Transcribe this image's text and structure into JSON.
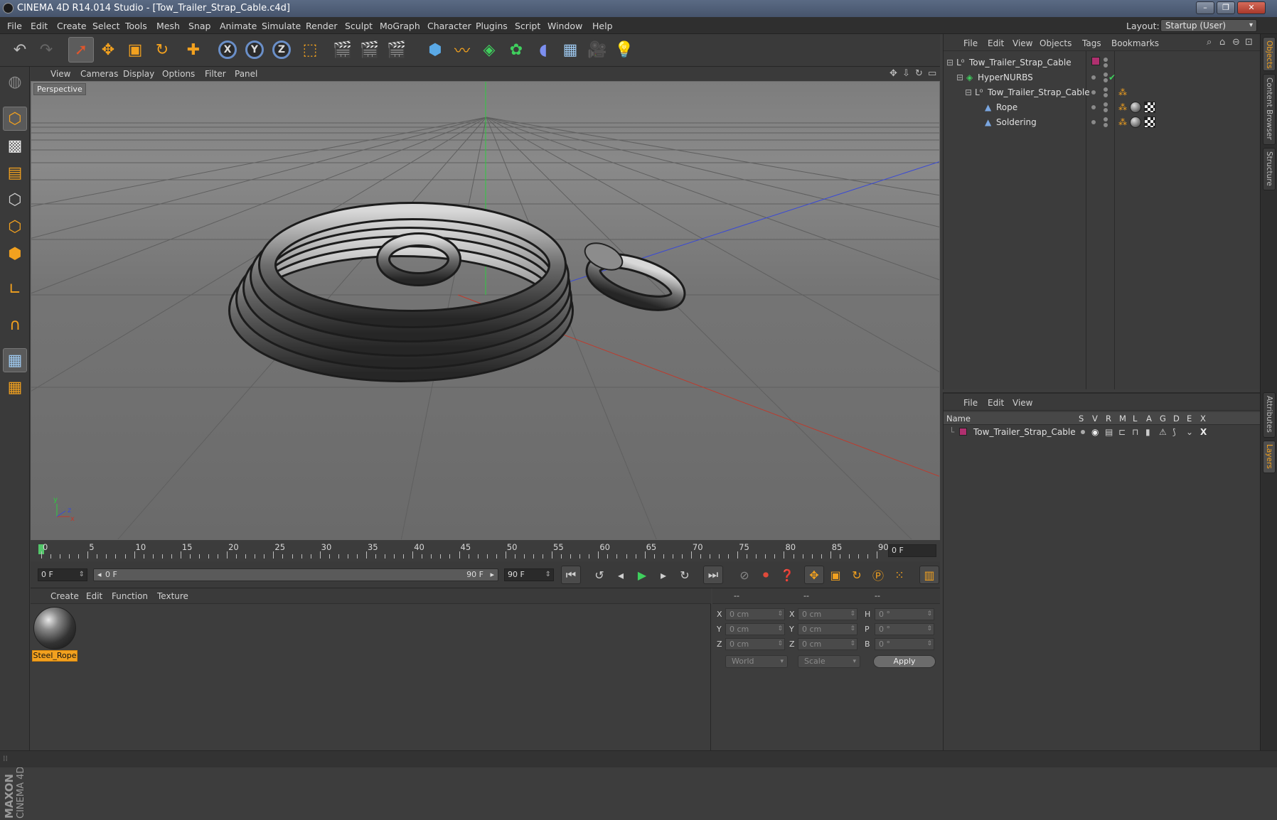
{
  "window": {
    "title": "CINEMA 4D R14.014 Studio - [Tow_Trailer_Strap_Cable.c4d]",
    "min": "–",
    "max": "❐",
    "close": "✕"
  },
  "menu": [
    "File",
    "Edit",
    "Create",
    "Select",
    "Tools",
    "Mesh",
    "Snap",
    "Animate",
    "Simulate",
    "Render",
    "Sculpt",
    "MoGraph",
    "Character",
    "Plugins",
    "Script",
    "Window",
    "Help"
  ],
  "layout": {
    "label": "Layout:",
    "value": "Startup (User)"
  },
  "toolbar": {
    "axis_x": "X",
    "axis_y": "Y",
    "axis_z": "Z"
  },
  "viewport": {
    "menu": [
      "View",
      "Cameras",
      "Display",
      "Options",
      "Filter",
      "Panel"
    ],
    "label": "Perspective",
    "axes": {
      "y": "y",
      "z": "z",
      "x": "x"
    }
  },
  "timeline": {
    "ticks": [
      "0",
      "5",
      "10",
      "15",
      "20",
      "25",
      "30",
      "35",
      "40",
      "45",
      "50",
      "55",
      "60",
      "65",
      "70",
      "75",
      "80",
      "85",
      "90"
    ],
    "current_frame": "0 F"
  },
  "transport": {
    "start": "0 F",
    "range_start": "0 F",
    "range_end": "90 F",
    "end": "90 F"
  },
  "materials": {
    "menu": [
      "Create",
      "Edit",
      "Function",
      "Texture"
    ],
    "items": [
      {
        "name": "Steel_Rope"
      }
    ]
  },
  "coords": {
    "headers": [
      "--",
      "--",
      "--"
    ],
    "rows": [
      {
        "l1": "X",
        "v1": "0 cm",
        "l2": "X",
        "v2": "0 cm",
        "l3": "H",
        "v3": "0 °"
      },
      {
        "l1": "Y",
        "v1": "0 cm",
        "l2": "Y",
        "v2": "0 cm",
        "l3": "P",
        "v3": "0 °"
      },
      {
        "l1": "Z",
        "v1": "0 cm",
        "l2": "Z",
        "v2": "0 cm",
        "l3": "B",
        "v3": "0 °"
      }
    ],
    "space": "World",
    "mode": "Scale",
    "apply": "Apply"
  },
  "objects": {
    "menu": [
      "File",
      "Edit",
      "View",
      "Objects",
      "Tags",
      "Bookmarks"
    ],
    "tree": [
      {
        "name": "Tow_Trailer_Strap_Cable",
        "icon": "null-icon"
      },
      {
        "name": "HyperNURBS",
        "icon": "hypernurbs-icon"
      },
      {
        "name": "Tow_Trailer_Strap_Cable",
        "icon": "null-icon"
      },
      {
        "name": "Rope",
        "icon": "polygon-icon"
      },
      {
        "name": "Soldering",
        "icon": "polygon-icon"
      }
    ]
  },
  "layers": {
    "menu": [
      "File",
      "Edit",
      "View"
    ],
    "columns": {
      "name": "Name",
      "flags": [
        "S",
        "V",
        "R",
        "M",
        "L",
        "A",
        "G",
        "D",
        "E",
        "X"
      ]
    },
    "rows": [
      {
        "name": "Tow_Trailer_Strap_Cable",
        "color": "#b0306f"
      }
    ]
  },
  "sidetabs": [
    "Objects",
    "Content Browser",
    "Structure",
    "Attributes",
    "Layers"
  ],
  "branding": {
    "line1": "MAXON",
    "line2": "CINEMA 4D"
  },
  "colors": {
    "accent": "#f2a11f",
    "axis_x": "#c0392b",
    "axis_y": "#2ecc40",
    "axis_z": "#3949d6",
    "layer": "#b0306f"
  }
}
